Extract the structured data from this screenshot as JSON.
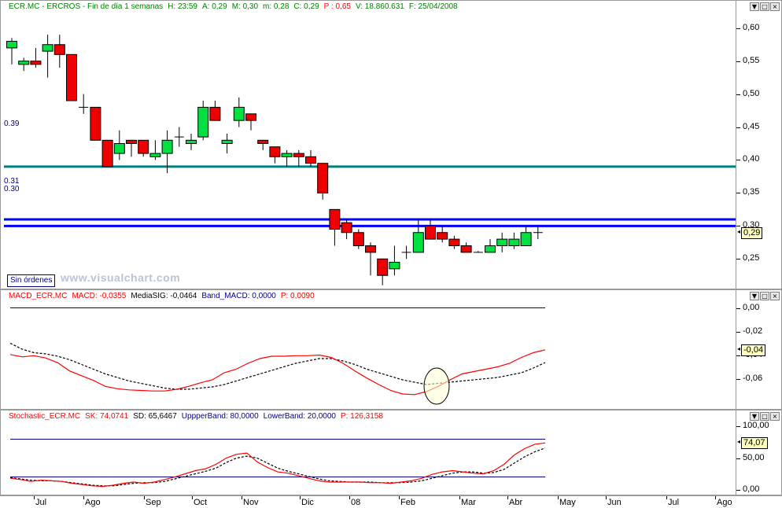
{
  "price_header": [
    {
      "text": "ECR.MC - ERCROS - Fin de día 1 semanas",
      "color": "#008000"
    },
    {
      "text": "H: 23:59",
      "color": "#008000"
    },
    {
      "text": "A: 0,29",
      "color": "#008000"
    },
    {
      "text": "M: 0,30",
      "color": "#008000"
    },
    {
      "text": "m: 0,28",
      "color": "#008000"
    },
    {
      "text": "C: 0,29",
      "color": "#008000"
    },
    {
      "text": "P : 0,65",
      "color": "#ff0000"
    },
    {
      "text": "V: 18.860.631",
      "color": "#008000"
    },
    {
      "text": "F: 25/04/2008",
      "color": "#008000"
    }
  ],
  "macd_header": [
    {
      "text": "MACD_ECR.MC",
      "color": "#ff0000"
    },
    {
      "text": "MACD: -0,0355",
      "color": "#ff0000"
    },
    {
      "text": "MediaSIG: -0,0464",
      "color": "#000000"
    },
    {
      "text": "Band_MACD: 0,0000",
      "color": "#000080"
    },
    {
      "text": "P: 0,0090",
      "color": "#ff0000"
    }
  ],
  "stoch_header": [
    {
      "text": "Stochastic_ECR.MC",
      "color": "#ff0000"
    },
    {
      "text": "SK: 74,0741",
      "color": "#ff0000"
    },
    {
      "text": "SD: 65,6467",
      "color": "#000000"
    },
    {
      "text": "UppperBand: 80,0000",
      "color": "#000080"
    },
    {
      "text": "LowerBand: 20,0000",
      "color": "#000080"
    },
    {
      "text": "P: 126,3158",
      "color": "#ff0000"
    }
  ],
  "ui": {
    "sin_ordenes": "Sin órdenes",
    "watermark": "www.visualchart.com",
    "axis_buttons": [
      "▼",
      "□",
      "×"
    ],
    "last_arrow": "◂"
  },
  "colors": {
    "up": "#00e040",
    "down": "#ee0000",
    "teal": "#008080",
    "blue": "#0000ff",
    "macd": "#ff0000",
    "signal": "#000000",
    "band": "#000080"
  },
  "chart_data": [
    {
      "type": "candlestick",
      "title": "ECR.MC - ERCROS - Fin de día 1 semanas",
      "ylim": [
        0.205,
        0.62
      ],
      "yticks": [
        "0,60",
        "0,55",
        "0,50",
        "0,45",
        "0,40",
        "0,35",
        "0,30",
        "0,25"
      ],
      "ytick_values": [
        0.6,
        0.55,
        0.5,
        0.45,
        0.4,
        0.35,
        0.3,
        0.25
      ],
      "last_value": "0,29",
      "horizontal_levels": [
        {
          "label": "0.39",
          "value": 0.39,
          "color": "#008080"
        },
        {
          "label": "0.31",
          "value": 0.31,
          "color": "#0000ff"
        },
        {
          "label": "0.30",
          "value": 0.3,
          "color": "#0000ff"
        }
      ],
      "candles": [
        {
          "o": 0.57,
          "h": 0.585,
          "l": 0.545,
          "c": 0.58
        },
        {
          "o": 0.545,
          "h": 0.555,
          "l": 0.535,
          "c": 0.55
        },
        {
          "o": 0.55,
          "h": 0.57,
          "l": 0.54,
          "c": 0.545
        },
        {
          "o": 0.565,
          "h": 0.59,
          "l": 0.525,
          "c": 0.575
        },
        {
          "o": 0.575,
          "h": 0.59,
          "l": 0.54,
          "c": 0.56
        },
        {
          "o": 0.56,
          "h": 0.56,
          "l": 0.49,
          "c": 0.49
        },
        {
          "o": 0.48,
          "h": 0.5,
          "l": 0.47,
          "c": 0.48
        },
        {
          "o": 0.48,
          "h": 0.48,
          "l": 0.43,
          "c": 0.43
        },
        {
          "o": 0.43,
          "h": 0.43,
          "l": 0.39,
          "c": 0.39
        },
        {
          "o": 0.41,
          "h": 0.445,
          "l": 0.4,
          "c": 0.425
        },
        {
          "o": 0.43,
          "h": 0.43,
          "l": 0.405,
          "c": 0.425
        },
        {
          "o": 0.43,
          "h": 0.43,
          "l": 0.405,
          "c": 0.41
        },
        {
          "o": 0.405,
          "h": 0.43,
          "l": 0.4,
          "c": 0.41
        },
        {
          "o": 0.41,
          "h": 0.445,
          "l": 0.38,
          "c": 0.43
        },
        {
          "o": 0.435,
          "h": 0.45,
          "l": 0.42,
          "c": 0.435
        },
        {
          "o": 0.425,
          "h": 0.44,
          "l": 0.415,
          "c": 0.43
        },
        {
          "o": 0.435,
          "h": 0.49,
          "l": 0.43,
          "c": 0.48
        },
        {
          "o": 0.48,
          "h": 0.49,
          "l": 0.46,
          "c": 0.46
        },
        {
          "o": 0.425,
          "h": 0.44,
          "l": 0.41,
          "c": 0.43
        },
        {
          "o": 0.46,
          "h": 0.495,
          "l": 0.45,
          "c": 0.48
        },
        {
          "o": 0.47,
          "h": 0.47,
          "l": 0.445,
          "c": 0.46
        },
        {
          "o": 0.43,
          "h": 0.43,
          "l": 0.415,
          "c": 0.425
        },
        {
          "o": 0.42,
          "h": 0.42,
          "l": 0.395,
          "c": 0.405
        },
        {
          "o": 0.405,
          "h": 0.415,
          "l": 0.39,
          "c": 0.41
        },
        {
          "o": 0.41,
          "h": 0.415,
          "l": 0.39,
          "c": 0.405
        },
        {
          "o": 0.405,
          "h": 0.415,
          "l": 0.39,
          "c": 0.395
        },
        {
          "o": 0.395,
          "h": 0.395,
          "l": 0.34,
          "c": 0.35
        },
        {
          "o": 0.325,
          "h": 0.325,
          "l": 0.27,
          "c": 0.295
        },
        {
          "o": 0.305,
          "h": 0.31,
          "l": 0.28,
          "c": 0.29
        },
        {
          "o": 0.29,
          "h": 0.295,
          "l": 0.265,
          "c": 0.27
        },
        {
          "o": 0.27,
          "h": 0.275,
          "l": 0.225,
          "c": 0.26
        },
        {
          "o": 0.25,
          "h": 0.25,
          "l": 0.21,
          "c": 0.225
        },
        {
          "o": 0.235,
          "h": 0.27,
          "l": 0.225,
          "c": 0.245
        },
        {
          "o": 0.26,
          "h": 0.27,
          "l": 0.25,
          "c": 0.26
        },
        {
          "o": 0.26,
          "h": 0.31,
          "l": 0.26,
          "c": 0.29
        },
        {
          "o": 0.3,
          "h": 0.31,
          "l": 0.28,
          "c": 0.28
        },
        {
          "o": 0.29,
          "h": 0.3,
          "l": 0.275,
          "c": 0.28
        },
        {
          "o": 0.28,
          "h": 0.285,
          "l": 0.265,
          "c": 0.27
        },
        {
          "o": 0.27,
          "h": 0.275,
          "l": 0.26,
          "c": 0.26
        },
        {
          "o": 0.26,
          "h": 0.262,
          "l": 0.26,
          "c": 0.26
        },
        {
          "o": 0.26,
          "h": 0.28,
          "l": 0.26,
          "c": 0.27
        },
        {
          "o": 0.27,
          "h": 0.29,
          "l": 0.26,
          "c": 0.28
        },
        {
          "o": 0.27,
          "h": 0.29,
          "l": 0.265,
          "c": 0.28
        },
        {
          "o": 0.27,
          "h": 0.3,
          "l": 0.27,
          "c": 0.29
        },
        {
          "o": 0.29,
          "h": 0.3,
          "l": 0.28,
          "c": 0.29
        }
      ]
    },
    {
      "type": "line",
      "title": "MACD_ECR.MC",
      "ylim": [
        -0.085,
        0.003
      ],
      "yticks": [
        "0,00",
        "-0,02",
        "-0,04",
        "-0,06"
      ],
      "ytick_values": [
        0.0,
        -0.02,
        -0.04,
        -0.06
      ],
      "last_value": "-0,04",
      "band": 0.0,
      "series": [
        {
          "name": "MACD",
          "values": [
            -0.0395,
            -0.0415,
            -0.0405,
            -0.0425,
            -0.0465,
            -0.0535,
            -0.0575,
            -0.0615,
            -0.0665,
            -0.0685,
            -0.0695,
            -0.07,
            -0.0705,
            -0.0705,
            -0.069,
            -0.0665,
            -0.0635,
            -0.061,
            -0.055,
            -0.052,
            -0.047,
            -0.043,
            -0.041,
            -0.041,
            -0.0405,
            -0.0405,
            -0.04,
            -0.042,
            -0.047,
            -0.0535,
            -0.0595,
            -0.065,
            -0.07,
            -0.073,
            -0.0735,
            -0.071,
            -0.0665,
            -0.061,
            -0.056,
            -0.054,
            -0.052,
            -0.05,
            -0.047,
            -0.042,
            -0.038,
            -0.0355
          ]
        },
        {
          "name": "MediaSIG",
          "values": [
            -0.03,
            -0.035,
            -0.038,
            -0.039,
            -0.041,
            -0.044,
            -0.048,
            -0.052,
            -0.056,
            -0.059,
            -0.062,
            -0.064,
            -0.066,
            -0.068,
            -0.069,
            -0.069,
            -0.068,
            -0.067,
            -0.065,
            -0.062,
            -0.059,
            -0.056,
            -0.053,
            -0.05,
            -0.047,
            -0.045,
            -0.043,
            -0.043,
            -0.045,
            -0.048,
            -0.052,
            -0.055,
            -0.058,
            -0.061,
            -0.063,
            -0.065,
            -0.064,
            -0.063,
            -0.062,
            -0.061,
            -0.06,
            -0.059,
            -0.057,
            -0.055,
            -0.051,
            -0.0464
          ]
        }
      ],
      "annotation": "circle at crossover"
    },
    {
      "type": "line",
      "title": "Stochastic_ECR.MC",
      "ylim": [
        -8,
        108
      ],
      "yticks": [
        "100,00",
        "50,00",
        "0,00"
      ],
      "ytick_values": [
        100,
        50,
        0
      ],
      "last_value": "74,07",
      "bands": [
        80,
        20
      ],
      "series": [
        {
          "name": "SK",
          "values": [
            18,
            16,
            13,
            15,
            14,
            13,
            10,
            8,
            6,
            5,
            7,
            10,
            12,
            10,
            12,
            16,
            20,
            25,
            30,
            33,
            40,
            50,
            56,
            58,
            44,
            35,
            28,
            26,
            22,
            18,
            14,
            12,
            12,
            12,
            12,
            11,
            11,
            10,
            12,
            14,
            18,
            24,
            28,
            30,
            28,
            26,
            25,
            30,
            40,
            55,
            65,
            72,
            74
          ]
        },
        {
          "name": "SD",
          "values": [
            19,
            17,
            15,
            14,
            14,
            13,
            11,
            9,
            7,
            6,
            6,
            8,
            10,
            11,
            11,
            13,
            17,
            21,
            25,
            29,
            34,
            43,
            50,
            53,
            50,
            42,
            34,
            29,
            25,
            21,
            17,
            14,
            13,
            12,
            12,
            12,
            11,
            11,
            11,
            12,
            14,
            18,
            22,
            26,
            28,
            28,
            26,
            27,
            32,
            42,
            52,
            60,
            66
          ]
        }
      ]
    }
  ],
  "time_axis": {
    "labels": [
      "Jul",
      "Ago",
      "Sep",
      "Oct",
      "Nov",
      "Dic",
      "08",
      "Feb",
      "Mar",
      "Abr",
      "May",
      "Jun",
      "Jul",
      "Ago"
    ]
  }
}
